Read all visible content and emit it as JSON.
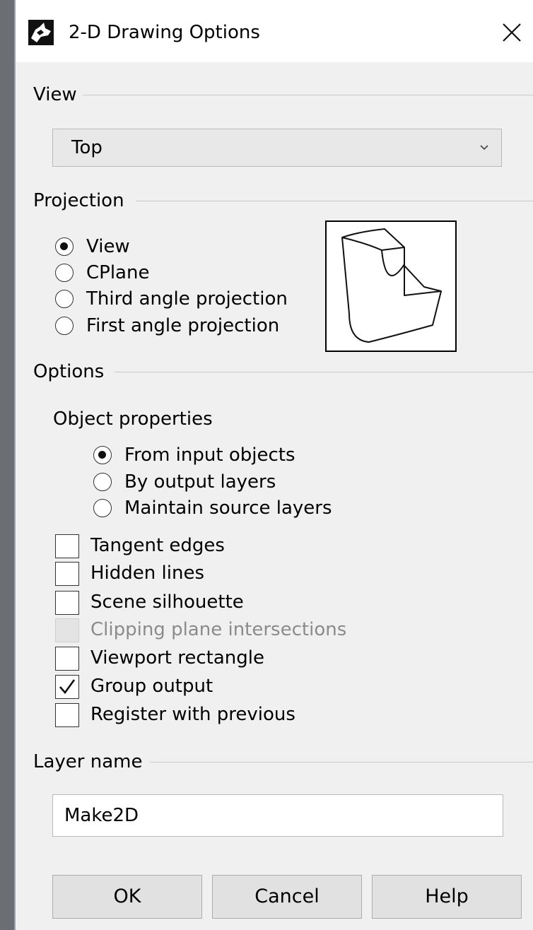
{
  "window": {
    "title": "2-D Drawing Options",
    "icon": "rhino-app-icon",
    "close_icon": "close-icon"
  },
  "view": {
    "section_label": "View",
    "selected": "Top"
  },
  "projection": {
    "section_label": "Projection",
    "options": [
      {
        "label": "View",
        "selected": true
      },
      {
        "label": "CPlane",
        "selected": false
      },
      {
        "label": "Third angle projection",
        "selected": false
      },
      {
        "label": "First angle projection",
        "selected": false
      }
    ]
  },
  "options": {
    "section_label": "Options",
    "object_properties": {
      "label": "Object properties",
      "choices": [
        {
          "label": "From input objects",
          "selected": true
        },
        {
          "label": "By output layers",
          "selected": false
        },
        {
          "label": "Maintain source layers",
          "selected": false
        }
      ]
    },
    "checkboxes": [
      {
        "label": "Tangent edges",
        "checked": false,
        "enabled": true
      },
      {
        "label": "Hidden lines",
        "checked": false,
        "enabled": true
      },
      {
        "label": "Scene silhouette",
        "checked": false,
        "enabled": true
      },
      {
        "label": "Clipping plane intersections",
        "checked": false,
        "enabled": false
      },
      {
        "label": "Viewport rectangle",
        "checked": false,
        "enabled": true
      },
      {
        "label": "Group output",
        "checked": true,
        "enabled": true
      },
      {
        "label": "Register with previous",
        "checked": false,
        "enabled": true
      }
    ]
  },
  "layer": {
    "section_label": "Layer name",
    "value": "Make2D"
  },
  "buttons": {
    "ok": "OK",
    "cancel": "Cancel",
    "help": "Help"
  }
}
